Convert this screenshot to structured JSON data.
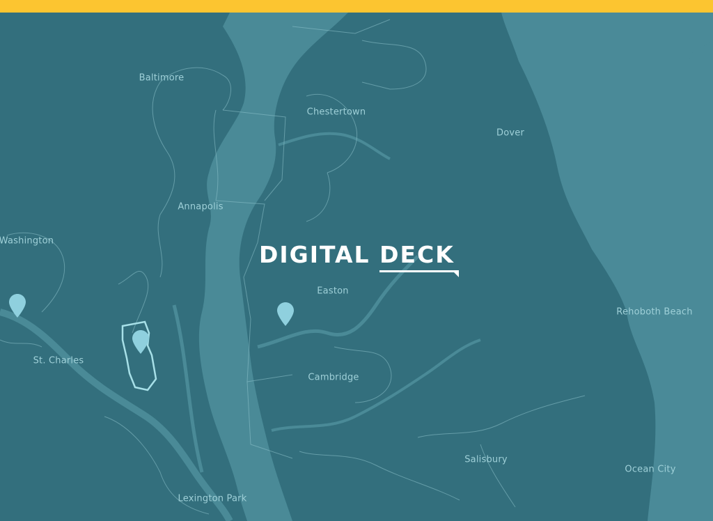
{
  "colors": {
    "top_bar": "#fcc530",
    "water": "#3a7a88",
    "land": "#336f7d",
    "bay": "#4a8a97",
    "ocean": "#4a8a98",
    "boundary": "#8ec3cc",
    "label": "#9fd0d8",
    "logo": "#ffffff",
    "marker": "#8fd0de",
    "highlight": "#a7e0e8"
  },
  "logo": {
    "part1": "DIGITAL",
    "part2": "DECK"
  },
  "cities": [
    {
      "id": "baltimore",
      "name": "Baltimore"
    },
    {
      "id": "chestertown",
      "name": "Chestertown"
    },
    {
      "id": "dover",
      "name": "Dover"
    },
    {
      "id": "annapolis",
      "name": "Annapolis"
    },
    {
      "id": "washington",
      "name": "Washington"
    },
    {
      "id": "easton",
      "name": "Easton"
    },
    {
      "id": "rehoboth-beach",
      "name": "Rehoboth Beach"
    },
    {
      "id": "st-charles",
      "name": "St. Charles"
    },
    {
      "id": "cambridge",
      "name": "Cambridge"
    },
    {
      "id": "salisbury",
      "name": "Salisbury"
    },
    {
      "id": "ocean-city",
      "name": "Ocean City"
    },
    {
      "id": "lexington-park",
      "name": "Lexington Park"
    }
  ],
  "markers": [
    {
      "id": "marker-washington",
      "icon": "map-pin-icon"
    },
    {
      "id": "marker-st-charles",
      "icon": "map-pin-icon"
    },
    {
      "id": "marker-easton",
      "icon": "map-pin-icon"
    }
  ]
}
